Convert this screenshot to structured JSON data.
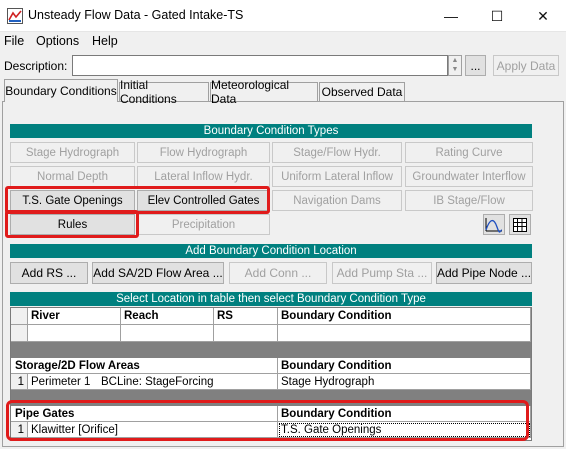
{
  "window": {
    "title": "Unsteady Flow Data - Gated Intake-TS",
    "minimize_glyph": "—",
    "maximize_glyph": "☐",
    "close_glyph": "✕"
  },
  "menu": [
    "File",
    "Options",
    "Help"
  ],
  "description": {
    "label": "Description:",
    "value": "",
    "ellipsis_label": "...",
    "apply_label": "Apply Data"
  },
  "tabs": [
    "Boundary Conditions",
    "Initial Conditions",
    "Meteorological Data",
    "Observed Data"
  ],
  "bc_types": {
    "header": "Boundary Condition Types",
    "row1": [
      "Stage Hydrograph",
      "Flow Hydrograph",
      "Stage/Flow Hydr.",
      "Rating Curve"
    ],
    "row2": [
      "Normal Depth",
      "Lateral Inflow Hydr.",
      "Uniform Lateral Inflow",
      "Groundwater Interflow"
    ],
    "row3": [
      "T.S. Gate Openings",
      "Elev Controlled Gates",
      "Navigation Dams",
      "IB Stage/Flow"
    ],
    "row4": [
      "Rules",
      "Precipitation"
    ]
  },
  "add_location": {
    "header": "Add Boundary Condition Location",
    "buttons": [
      "Add RS ...",
      "Add SA/2D Flow Area ...",
      "Add Conn ...",
      "Add Pump Sta ...",
      "Add Pipe Node ..."
    ]
  },
  "table": {
    "header": "Select Location in table then select Boundary Condition Type",
    "columns": [
      "River",
      "Reach",
      "RS",
      "Boundary Condition"
    ],
    "storage_section": "Storage/2D Flow Areas",
    "storage_bc_header": "Boundary Condition",
    "storage_rows": [
      {
        "num": "1",
        "location": "Perimeter 1",
        "bcline": "BCLine: StageForcing",
        "bc": "Stage Hydrograph"
      }
    ],
    "pipe_section": "Pipe Gates",
    "pipe_bc_header": "Boundary Condition",
    "pipe_rows": [
      {
        "num": "1",
        "location": "Klawitter [Orifice]",
        "bc": "T.S. Gate Openings"
      }
    ]
  }
}
